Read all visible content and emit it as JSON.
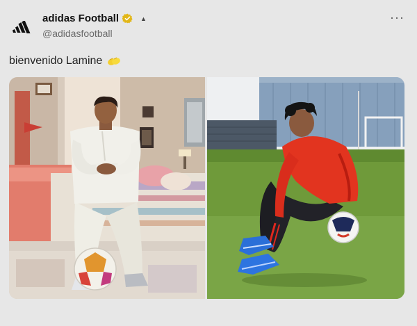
{
  "author": {
    "display_name": "adidas Football",
    "handle": "@adidasfootball",
    "avatar_icon": "adidas-logo-icon",
    "verified_icon": "verified-badge-icon",
    "verified_color": "#e2b719"
  },
  "menu": {
    "more_label": "···"
  },
  "tweet": {
    "text": "bienvenido Lamine",
    "emoji_icon": "raised-hands-icon"
  },
  "media": {
    "images": [
      {
        "name": "photo-bedroom"
      },
      {
        "name": "photo-pitch"
      }
    ]
  },
  "colors": {
    "background": "#e7e7e7",
    "accent_red": "#e0281e",
    "grass": "#6f9a3a"
  }
}
